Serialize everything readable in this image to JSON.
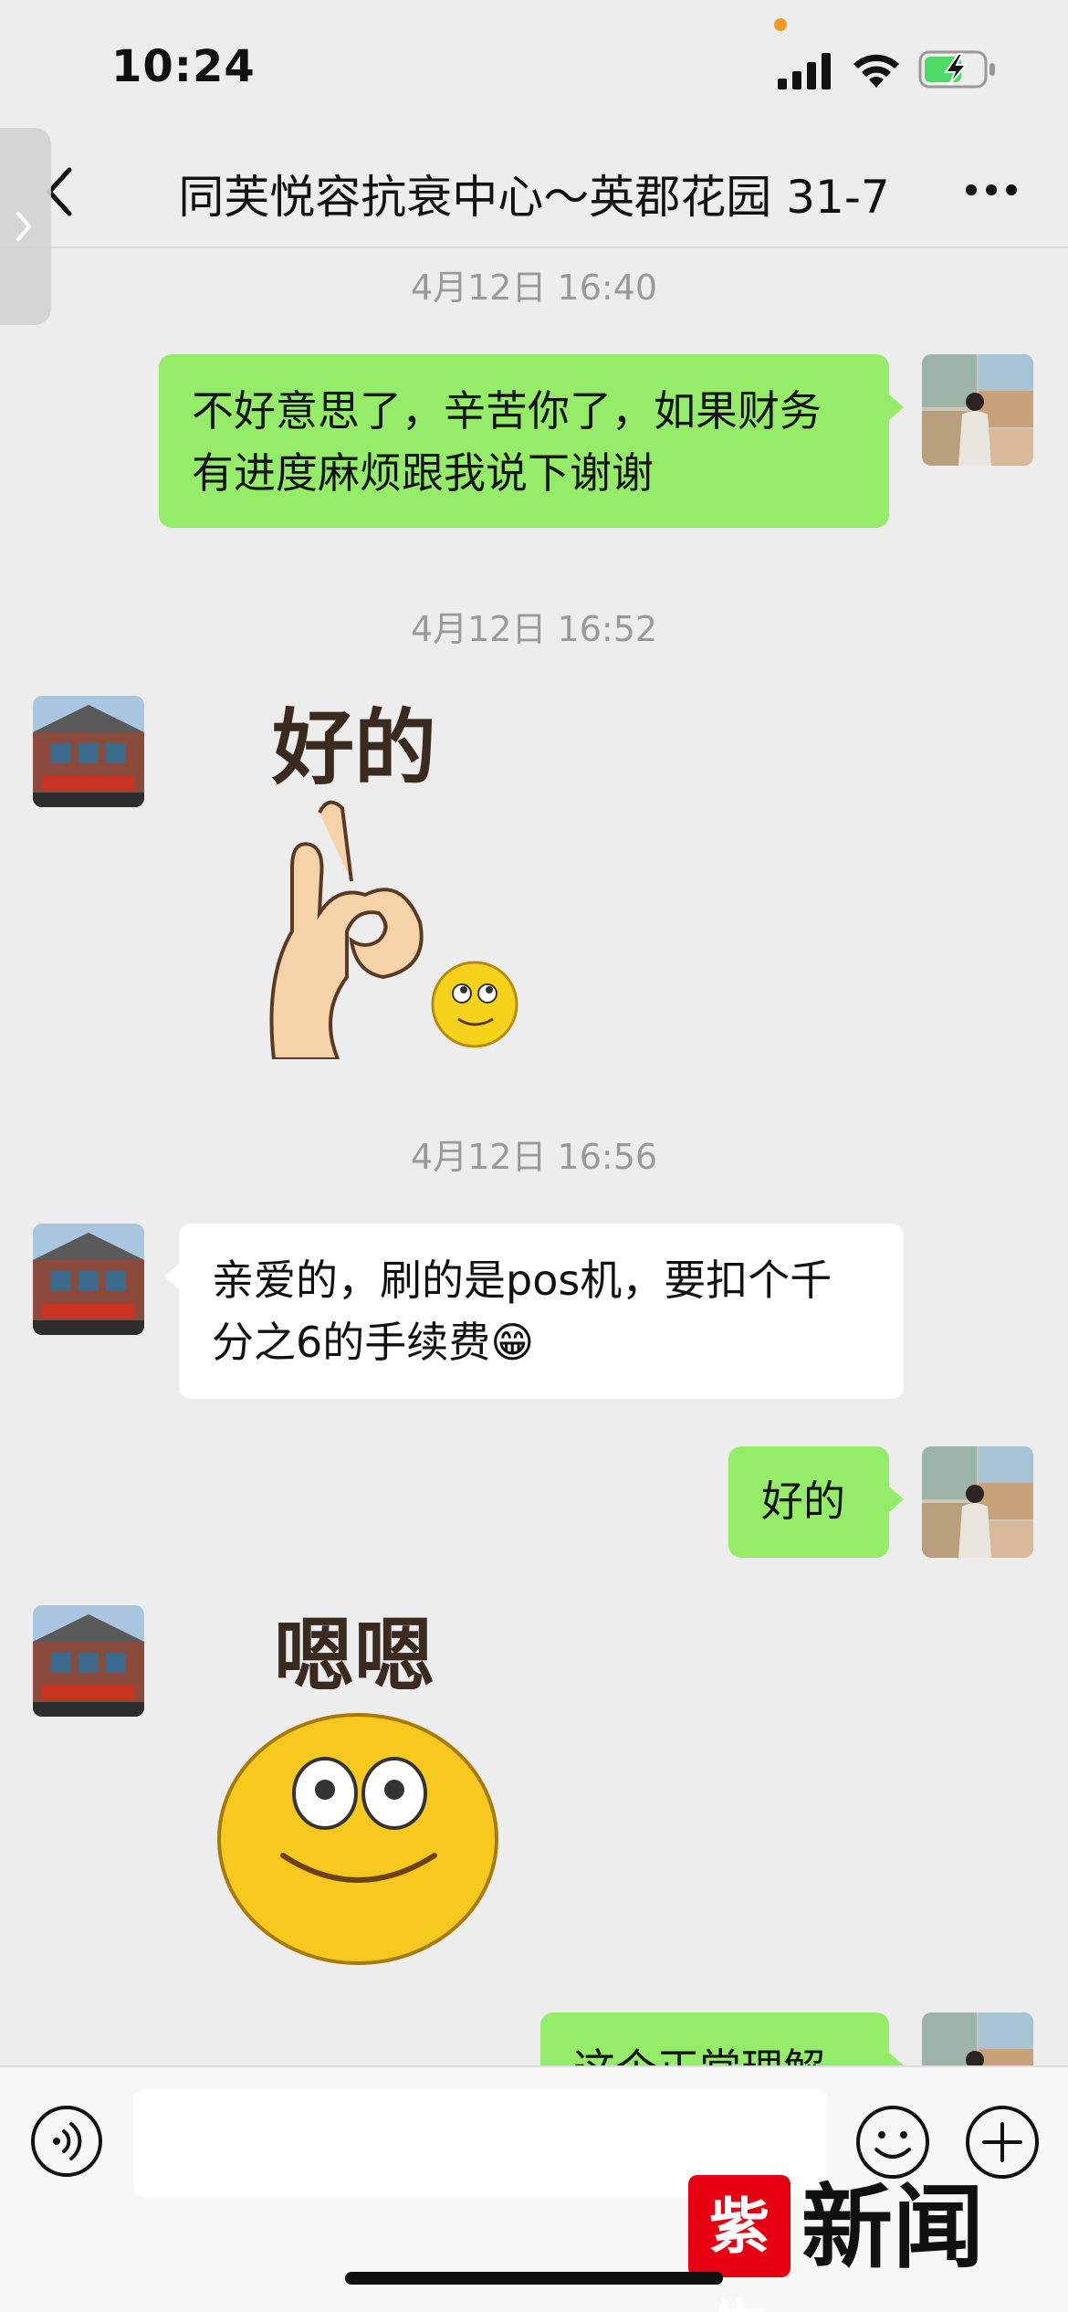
{
  "status_bar": {
    "time": "10:24"
  },
  "nav": {
    "title": "同芙悦容抗衰中心～英郡花园 31-7"
  },
  "messages": {
    "t1": "4月12日 16:40",
    "m1": "不好意思了，辛苦你了，如果财务有进度麻烦跟我说下谢谢",
    "t2": "4月12日 16:52",
    "sticker1": "好的",
    "t3": "4月12日 16:56",
    "m2": "亲爱的，刷的是pos机，要扣个千分之6的手续费",
    "m2_emoji": "😁",
    "m3": "好的",
    "sticker2": "嗯嗯",
    "m4": "这个正常理解"
  },
  "input": {
    "placeholder": ""
  },
  "watermark": {
    "logo": "紫牛",
    "text": "新闻"
  },
  "colors": {
    "bubble_out": "#95ec69",
    "bubble_in": "#ffffff",
    "background": "#ededed"
  },
  "icons": [
    "signal-icon",
    "wifi-icon",
    "battery-charging-icon",
    "back-icon",
    "more-icon",
    "voice-icon",
    "emoji-icon",
    "plus-icon"
  ]
}
